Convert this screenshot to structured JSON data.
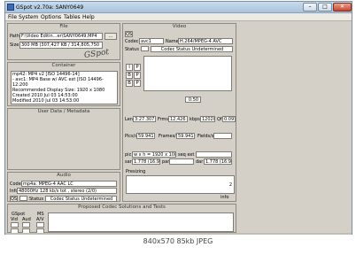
{
  "window": {
    "title": "GSpot v2.70a: SANY0649",
    "buttons": {
      "minimize": "–",
      "maximize": "□",
      "close": "✕"
    }
  },
  "menu": [
    "File",
    "System",
    "Options",
    "Tables",
    "Help"
  ],
  "file_panel": {
    "header": "File",
    "path_label": "Path",
    "path_value": "F:\\Video Editin...er\\SANY0649.MP4",
    "path_btn": "...",
    "size_label": "Size",
    "size_value": "300 MB (307,427 KB / 314,805,750",
    "logo": "GSpot"
  },
  "container_panel": {
    "header": "Container",
    "lines": [
      "mp42: MP4 v2 [ISO 14496-14]",
      "- avc1: MP4 Base w/ AVC ext [ISO 14496-12:200",
      "Recommended Display Size: 1920 x 1080",
      "Created    2010 Jul 03  14:53:00",
      "Modified   2010 Jul 03  14:53:00"
    ]
  },
  "userdata_panel": {
    "header": "User Data / Metadata"
  },
  "audio_panel": {
    "header": "Audio",
    "codec_label": "Codec",
    "codec_value": "mp4a: MPEG-4 AAC LC",
    "info_label": "Info",
    "info_value": "48000Hz  128 kb/s tot , stereo (2/0)",
    "qs": "QS",
    "status_label": "Status",
    "status_value": "Codec Status Undetermined"
  },
  "proposed_panel": {
    "header": "Proposed Codec Solutions and Tests",
    "gspot_label": "GSpot",
    "ms_label": "MS",
    "vid_label": "Vid",
    "aud_label": "Aud",
    "av_label": "A/V"
  },
  "video_panel": {
    "header": "Video",
    "qs": "QS",
    "codec_label": "Codec",
    "codec_value": "avc1",
    "name_label": "Name",
    "name_value": "H.264/MPEG-4 AVC",
    "status_label": "Status",
    "status_value": "Codec Status Undetermined",
    "frame_types": [
      "I",
      "P",
      "B",
      "P",
      "B",
      "P"
    ],
    "i_label": "0:50",
    "len_label": "Len",
    "len_value": "3:27.307",
    "frms_label": "Frms",
    "frms_value": "12,426",
    "kbps_label": "kbps",
    "kbps_value": "12020",
    "qf_label": "Qf",
    "qf_value": "0.097",
    "pics_label": "Pics/s",
    "pics_value": "59.941",
    "frames_label": "Frames/s",
    "frames_value": "59.941",
    "fields_label": "Fields/s",
    "fields_value": "",
    "pic_label": "pic",
    "pic_value": "w x h = 1920 x 1080",
    "seq_label": "seq ext",
    "sar_label": "sar",
    "sar_value": "1.778 (16:9)",
    "par_label": "par",
    "dar_label": "dar",
    "dar_value": "1.778 (16:9)",
    "presizing_label": "Presizing",
    "presizing_count": "2",
    "info_label": "info"
  },
  "caption": "840x570  85kb  JPEG"
}
